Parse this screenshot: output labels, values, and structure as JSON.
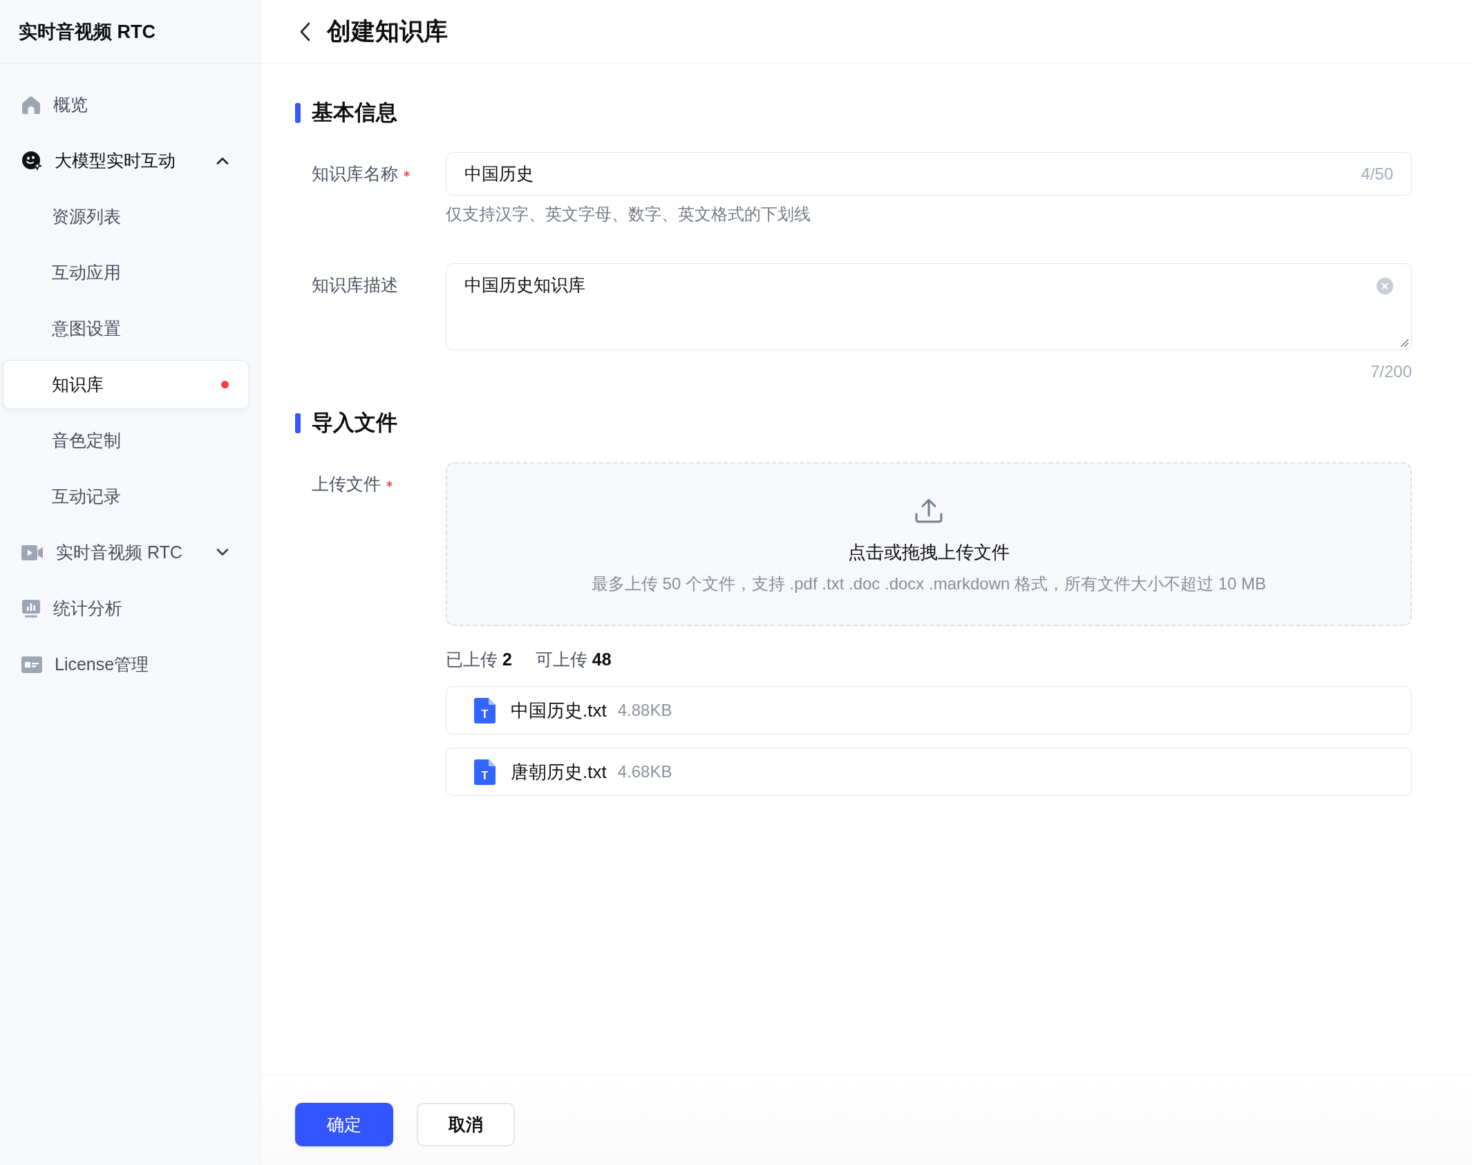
{
  "sidebar": {
    "title": "实时音视频 RTC",
    "items": [
      {
        "kind": "link",
        "label": "概览",
        "selected": false
      },
      {
        "kind": "group",
        "label": "大模型实时互动",
        "selected": false,
        "expanded": true,
        "children": [
          {
            "label": "资源列表",
            "selected": false,
            "dot": false
          },
          {
            "label": "互动应用",
            "selected": false,
            "dot": false
          },
          {
            "label": "意图设置",
            "selected": false,
            "dot": false
          },
          {
            "label": "知识库",
            "selected": true,
            "dot": true
          },
          {
            "label": "音色定制",
            "selected": false,
            "dot": false
          },
          {
            "label": "互动记录",
            "selected": false,
            "dot": false
          }
        ]
      },
      {
        "kind": "group",
        "label": "实时音视频 RTC",
        "selected": false,
        "expanded": false
      },
      {
        "kind": "link",
        "label": "统计分析",
        "selected": false
      },
      {
        "kind": "link",
        "label": "License管理",
        "selected": false
      }
    ]
  },
  "header": {
    "title": "创建知识库"
  },
  "sections": [
    {
      "title": "基本信息",
      "fields": [
        {
          "kind": "input",
          "label": "知识库名称",
          "required": true,
          "value": "中国历史",
          "counter": "4/50",
          "hint": "仅支持汉字、英文字母、数字、英文格式的下划线"
        },
        {
          "kind": "textarea",
          "label": "知识库描述",
          "required": false,
          "value": "中国历史知识库",
          "counter": "7/200",
          "clear_button": true
        }
      ]
    },
    {
      "title": "导入文件",
      "fields": [
        {
          "kind": "upload",
          "label": "上传文件",
          "required": true,
          "prompt": "点击或拖拽上传文件",
          "hint": "最多上传 50 个文件，支持 .pdf .txt .doc .docx .markdown 格式，所有文件大小不超过 10 MB",
          "counts": [
            "已上传 **2**",
            "可上传 **48**"
          ],
          "files": [
            {
              "name": "中国历史.txt",
              "size": "4.88KB",
              "icon_letter": "T"
            },
            {
              "name": "唐朝历史.txt",
              "size": "4.68KB",
              "icon_letter": "T"
            }
          ]
        }
      ]
    }
  ],
  "footer": {
    "buttons": [
      {
        "kind": "primary",
        "label": "确定"
      },
      {
        "kind": "secondary",
        "label": "取消"
      }
    ]
  }
}
